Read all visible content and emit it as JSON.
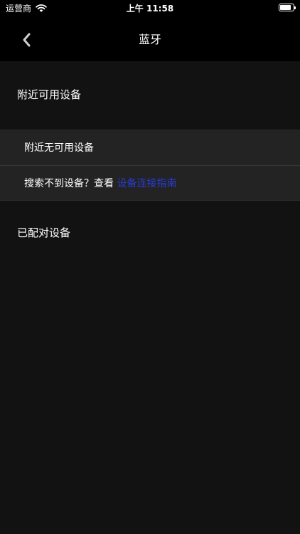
{
  "status_bar": {
    "carrier": "运营商",
    "time": "上午 11:58",
    "wifi_icon": "wifi-icon",
    "battery_icon": "battery-icon",
    "battery_level": 0.85
  },
  "nav": {
    "back_icon": "chevron-left-icon",
    "title": "蓝牙"
  },
  "sections": {
    "nearby_title": "附近可用设备",
    "no_device_text": "附近无可用设备",
    "not_found_prefix": "搜索不到设备？查看",
    "guide_link": "设备连接指南",
    "paired_title": "已配对设备"
  },
  "colors": {
    "link": "#2a3bd6",
    "background": "#121212",
    "card": "#232323",
    "bar": "#000000"
  }
}
